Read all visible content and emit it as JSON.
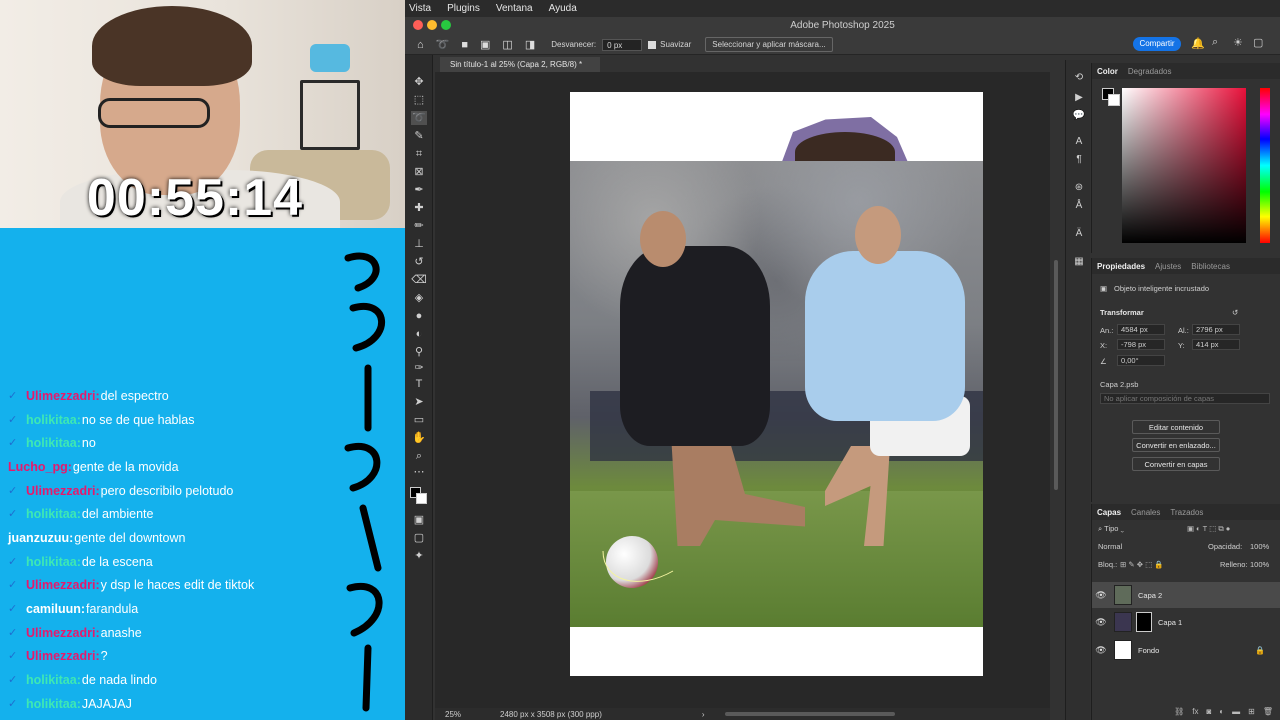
{
  "stream": {
    "timer": "00:55:14",
    "chat": [
      {
        "user": "Ulimezzadri:",
        "text": " del espectro",
        "color": "#e6196c",
        "badge": true
      },
      {
        "user": "holikitaa:",
        "text": " no se de que hablas",
        "color": "#3ee8b3",
        "badge": true
      },
      {
        "user": "holikitaa:",
        "text": " no",
        "color": "#3ee8b3",
        "badge": true
      },
      {
        "user": "Lucho_pg:",
        "text": " gente de la movida",
        "color": "#e6196c",
        "badge": false
      },
      {
        "user": "Ulimezzadri:",
        "text": " pero describilo pelotudo",
        "color": "#e6196c",
        "badge": true
      },
      {
        "user": "holikitaa:",
        "text": " del ambiente",
        "color": "#3ee8b3",
        "badge": true
      },
      {
        "user": "juanzuzuu:",
        "text": " gente del downtown",
        "color": "#ffffff",
        "badge": false
      },
      {
        "user": "holikitaa:",
        "text": " de la escena",
        "color": "#3ee8b3",
        "badge": true
      },
      {
        "user": "Ulimezzadri:",
        "text": " y dsp le haces edit de tiktok",
        "color": "#e6196c",
        "badge": true
      },
      {
        "user": "camiluun:",
        "text": " farandula",
        "color": "#ffffff",
        "badge": true
      },
      {
        "user": "Ulimezzadri:",
        "text": " anashe",
        "color": "#e6196c",
        "badge": true
      },
      {
        "user": "Ulimezzadri:",
        "text": " ?",
        "color": "#e6196c",
        "badge": true
      },
      {
        "user": "holikitaa:",
        "text": " de nada lindo",
        "color": "#3ee8b3",
        "badge": true
      },
      {
        "user": "holikitaa:",
        "text": " JAJAJAJ",
        "color": "#3ee8b3",
        "badge": true
      }
    ]
  },
  "menu": [
    "Vista",
    "Plugins",
    "Ventana",
    "Ayuda"
  ],
  "app_title": "Adobe Photoshop 2025",
  "options": {
    "feather_label": "Desvanecer:",
    "feather_value": "0 px",
    "smooth_label": "Suavizar",
    "mask_button": "Seleccionar y aplicar máscara...",
    "share_button": "Compartir"
  },
  "document": {
    "tab": "Sin título-1 al 25% (Capa 2, RGB/8) *",
    "zoom": "25%",
    "info": "2480 px x 3508 px (300 ppp)"
  },
  "color_panel": {
    "tabs": [
      "Color",
      "Degradados"
    ],
    "accent": "#e8103a"
  },
  "properties": {
    "tabs": [
      "Propiedades",
      "Ajustes",
      "Bibliotecas"
    ],
    "object_type": "Objeto inteligente incrustado",
    "transform_label": "Transformar",
    "w_label": "An.:",
    "w_value": "4584 px",
    "h_label": "Al.:",
    "h_value": "2796 px",
    "x_label": "X:",
    "x_value": "-798 px",
    "y_label": "Y:",
    "y_value": "414 px",
    "angle_value": "0,00°",
    "file": "Capa 2.psb",
    "comp_placeholder": "No aplicar composición de capas",
    "btn_edit": "Editar contenido",
    "btn_link": "Convertir en enlazado...",
    "btn_layers": "Convertir en capas"
  },
  "layers_panel": {
    "tabs": [
      "Capas",
      "Canales",
      "Trazados"
    ],
    "filter": "Tipo",
    "blend_mode": "Normal",
    "opacity_label": "Opacidad:",
    "opacity_value": "100%",
    "lock_label": "Bloq.:",
    "fill_label": "Relleno:",
    "fill_value": "100%",
    "layers": [
      "Capa 2",
      "Capa 1",
      "Fondo"
    ]
  }
}
